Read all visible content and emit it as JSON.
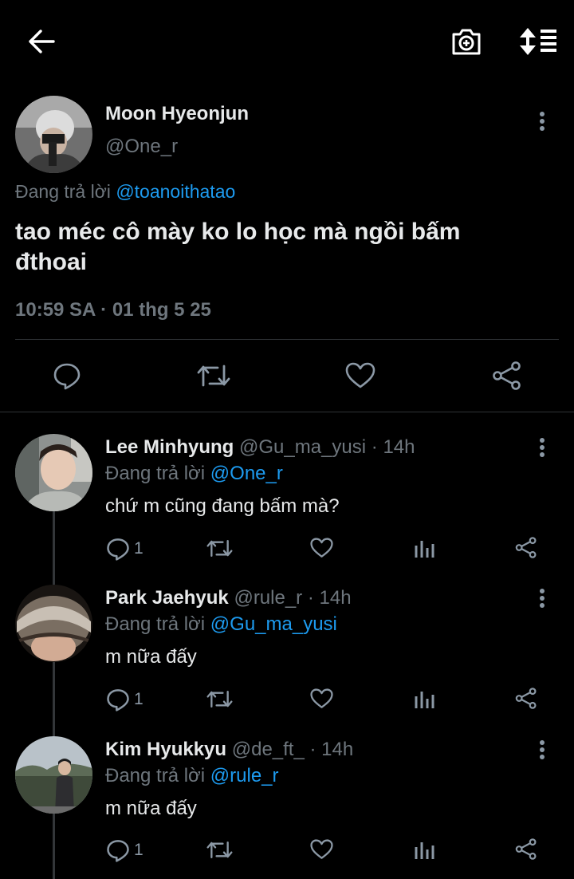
{
  "colors": {
    "background": "#000000",
    "text": "#e7e9ea",
    "muted": "#6e767d",
    "link": "#1d9bf0",
    "divider": "#2f3336"
  },
  "header": {
    "back_icon": "arrow-left-icon",
    "camera_icon": "camera-plus-icon",
    "sort_icon": "sort-icon"
  },
  "main_tweet": {
    "author_name": "Moon Hyeonjun",
    "author_handle": "@One_r",
    "replying_prefix": "Đang trả lời",
    "replying_to": "@toanoithatao",
    "text_line1": "tao méc cô mày ko lo học mà ngồi bấm",
    "text_line2": "đthoai",
    "timestamp": "10:59 SA · 01 thg 5 25"
  },
  "replies": [
    {
      "author_name": "Lee Minhyung",
      "handle_time": "@Gu_ma_yusi · 14h",
      "replying_prefix": "Đang trả lời",
      "replying_to": "@One_r",
      "text": "chứ m cũng đang bấm mà?",
      "reply_count": "1"
    },
    {
      "author_name": "Park Jaehyuk",
      "handle_time": "@rule_r · 14h",
      "replying_prefix": "Đang trả lời",
      "replying_to": "@Gu_ma_yusi",
      "text": "m nữa đấy",
      "reply_count": "1"
    },
    {
      "author_name": "Kim Hyukkyu",
      "handle_time": "@de_ft_ · 14h",
      "replying_prefix": "Đang trả lời",
      "replying_to": "@rule_r",
      "text": "m nữa đấy",
      "reply_count": "1"
    }
  ]
}
